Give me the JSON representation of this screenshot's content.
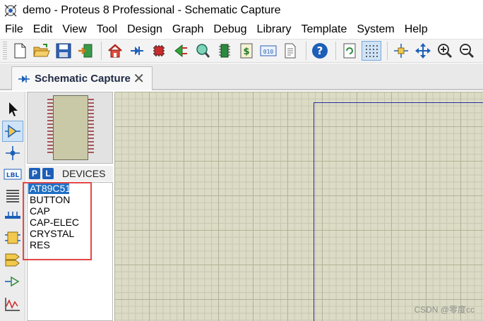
{
  "window": {
    "title": "demo - Proteus 8 Professional - Schematic Capture"
  },
  "menu": [
    "File",
    "Edit",
    "View",
    "Tool",
    "Design",
    "Graph",
    "Debug",
    "Library",
    "Template",
    "System",
    "Help"
  ],
  "tab": {
    "label": "Schematic Capture",
    "close": "✕"
  },
  "devices": {
    "p_label": "P",
    "l_label": "L",
    "title": "DEVICES",
    "items": [
      "AT89C51",
      "BUTTON",
      "CAP",
      "CAP-ELEC",
      "CRYSTAL",
      "RES"
    ],
    "selected": "AT89C51"
  },
  "left_tools": {
    "lbl": "LBL"
  },
  "watermark": "CSDN @零度cc",
  "colors": {
    "accent": "#1f6fc4",
    "canvas": "#dcdcc6",
    "sheet_border": "#2a2aa0",
    "highlight_box": "#e14747"
  }
}
